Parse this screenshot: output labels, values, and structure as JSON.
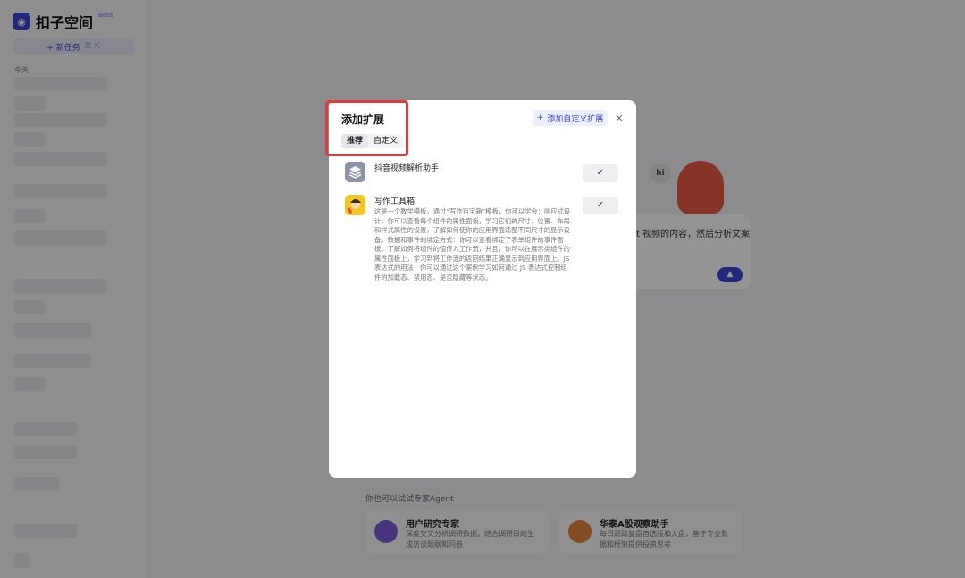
{
  "app": {
    "logo_text": "扣子空间",
    "logo_badge": "Beta",
    "new_task_label": "+ 新任务",
    "shortcut_hint": "⌘ K",
    "history_group": "今天"
  },
  "main": {
    "prompt_preview": "t 视频的内容，然后分析文案",
    "hi_badge": "hi",
    "send_icon": "▲",
    "agents_heading": "你也可以试试专家Agent",
    "agents": [
      {
        "title": "用户研究专家",
        "desc": "深度交叉分析调研数据，结合调研目的生成访谈题纲和问卷"
      },
      {
        "title": "华泰A股观察助手",
        "desc": "每日跟踪复盘自选股和大盘，基于专业数据和框架提供投资思考"
      }
    ]
  },
  "modal": {
    "title": "添加扩展",
    "tabs": [
      "推荐",
      "自定义"
    ],
    "add_custom_label": "添加自定义扩展",
    "close_icon": "×",
    "extensions": [
      {
        "name": "抖音视频解析助手",
        "desc": "",
        "checked": true,
        "icon": "layers-icon"
      },
      {
        "name": "写作工具箱",
        "desc": "这是一个教学模板，通过“写作百宝箱”模板，你可以学会：响应式设计：你可以查看每个组件的属性面板，学习它们的尺寸、位置、布局和样式属性的设置，了解如何使你的应用界面适配不同尺寸的显示设备。数据和事件的绑定方式：你可以查看绑定了表单组件的事件面板，了解如何将组件的值传入工作流，并且，你可以在展示类组件的属性面板上，学习到将工作流的返回结果正确显示到应用界面上。JS 表达式的用法：你可以通过这个案例学习如何通过 JS 表达式控制组件的加载态、禁用态、是否隐藏等状态。",
        "checked": true,
        "icon": "writing-avatar-icon"
      }
    ]
  },
  "colors": {
    "accent": "#3b44d6",
    "highlight": "#e23b3b"
  }
}
